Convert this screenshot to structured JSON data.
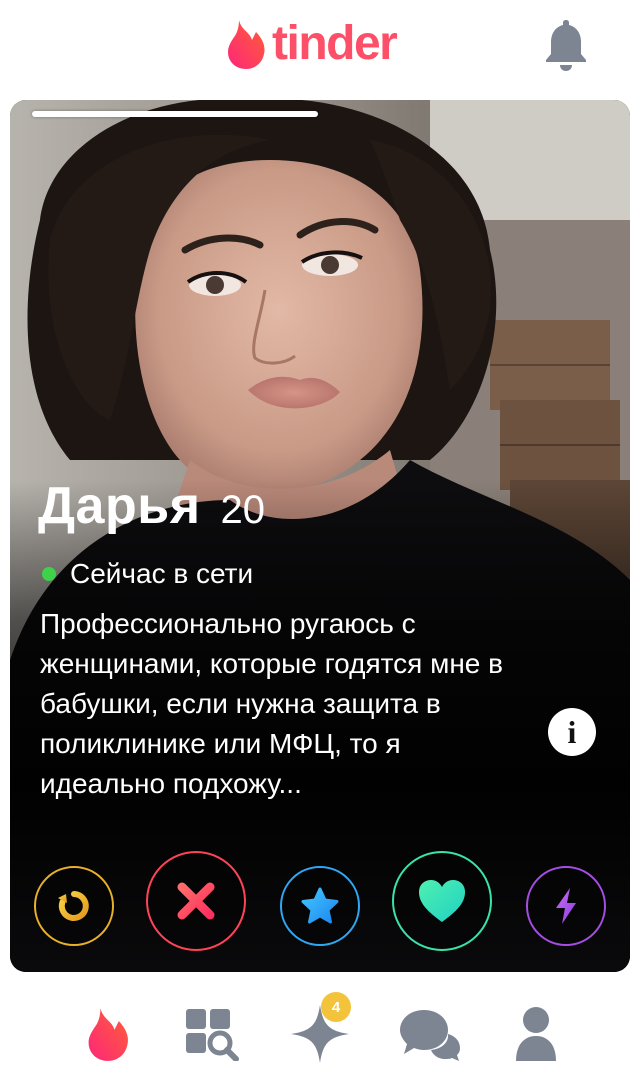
{
  "header": {
    "logo_text": "tinder",
    "logo_icon": "flame-icon",
    "notifications_icon": "bell-icon"
  },
  "card": {
    "photo_count": 1,
    "name": "Дарья",
    "age": "20",
    "status": "Сейчас в сети",
    "status_color": "#3fd14a",
    "bio": "Профессионально ругаюсь с женщинами, которые годятся мне в бабушки, если нужна защита в поликлинике или МФЦ, то я идеально подхожу...",
    "info_label": "i"
  },
  "actions": [
    {
      "icon": "rewind-icon",
      "color": "#e9b12a"
    },
    {
      "icon": "nope-x-icon",
      "color": "#ff4458"
    },
    {
      "icon": "super-like-star-icon",
      "color": "#2fa8f4"
    },
    {
      "icon": "like-heart-icon",
      "color": "#39e3aa"
    },
    {
      "icon": "boost-bolt-icon",
      "color": "#a64ee3"
    }
  ],
  "bottom_nav": {
    "items": [
      {
        "icon": "flame-icon",
        "active": true
      },
      {
        "icon": "explore-grid-icon",
        "active": false
      },
      {
        "icon": "sparkle-icon",
        "active": false,
        "badge": "4"
      },
      {
        "icon": "chat-bubbles-icon",
        "active": false
      },
      {
        "icon": "profile-icon",
        "active": false
      }
    ]
  },
  "colors": {
    "brand": "#fd5068",
    "nav_inactive": "#7c8591"
  }
}
